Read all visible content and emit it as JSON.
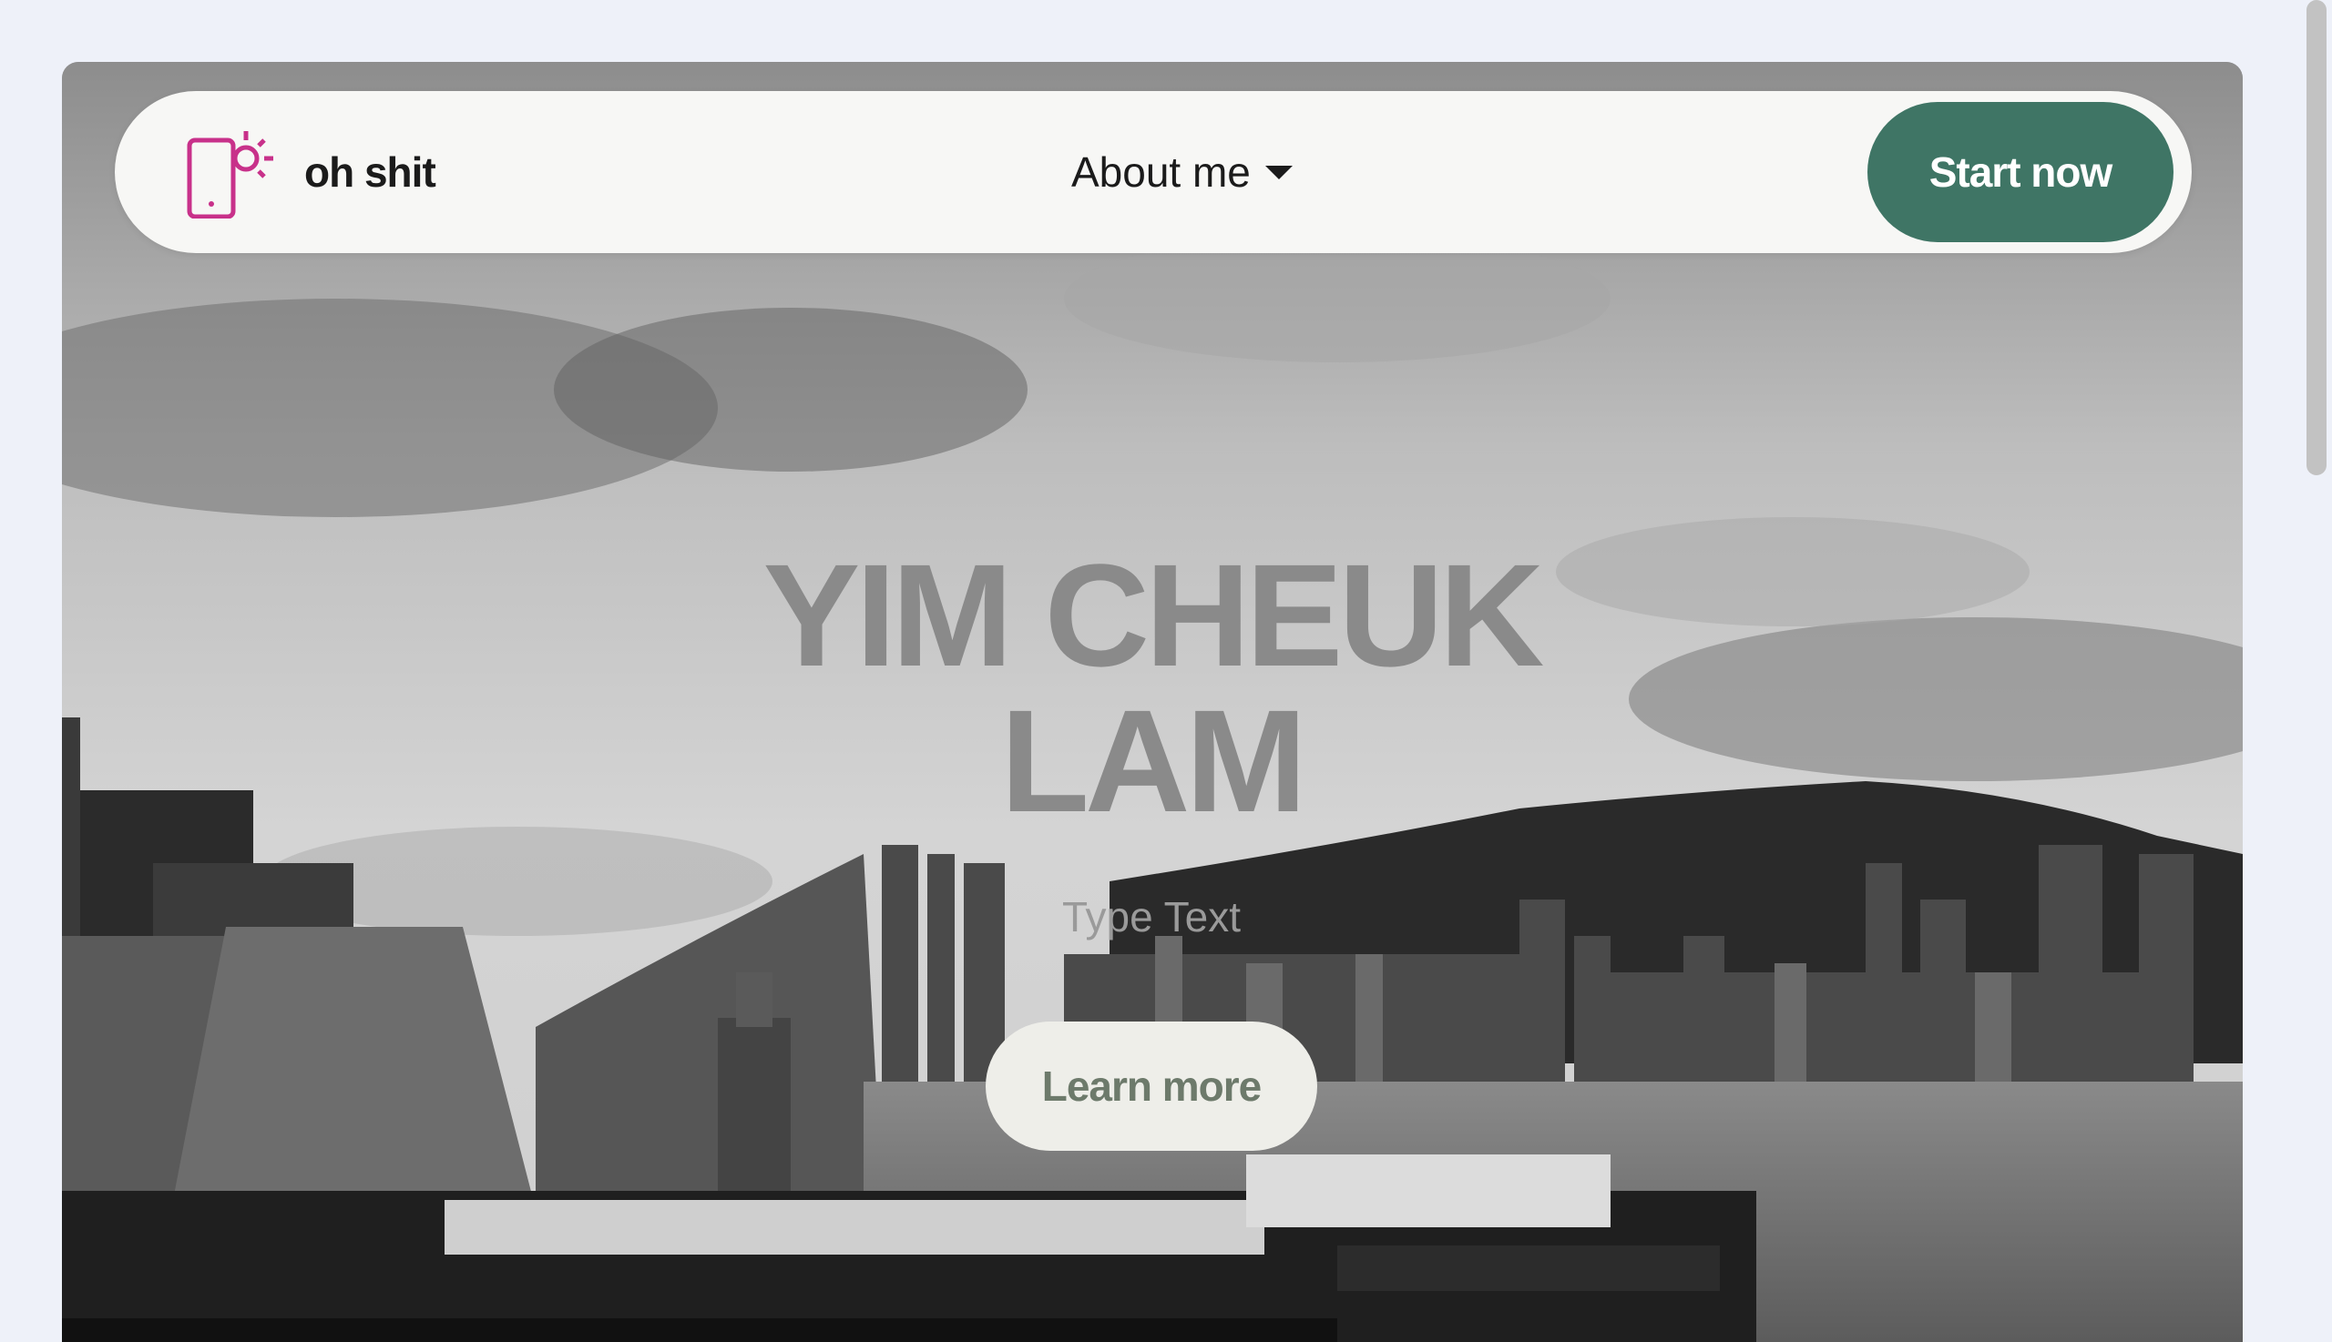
{
  "navbar": {
    "brand": "oh shit",
    "about_label": "About me",
    "start_label": "Start now"
  },
  "hero": {
    "title_line1": "YIM CHEUK",
    "title_line2": "LAM",
    "subtext": "Type Text",
    "learn_label": "Learn more"
  },
  "colors": {
    "page_bg": "#eef1f9",
    "accent_green": "#3f7565",
    "logo_magenta": "#c8318a"
  },
  "icons": [
    "phone-sun-logo-icon",
    "chevron-down-icon"
  ]
}
